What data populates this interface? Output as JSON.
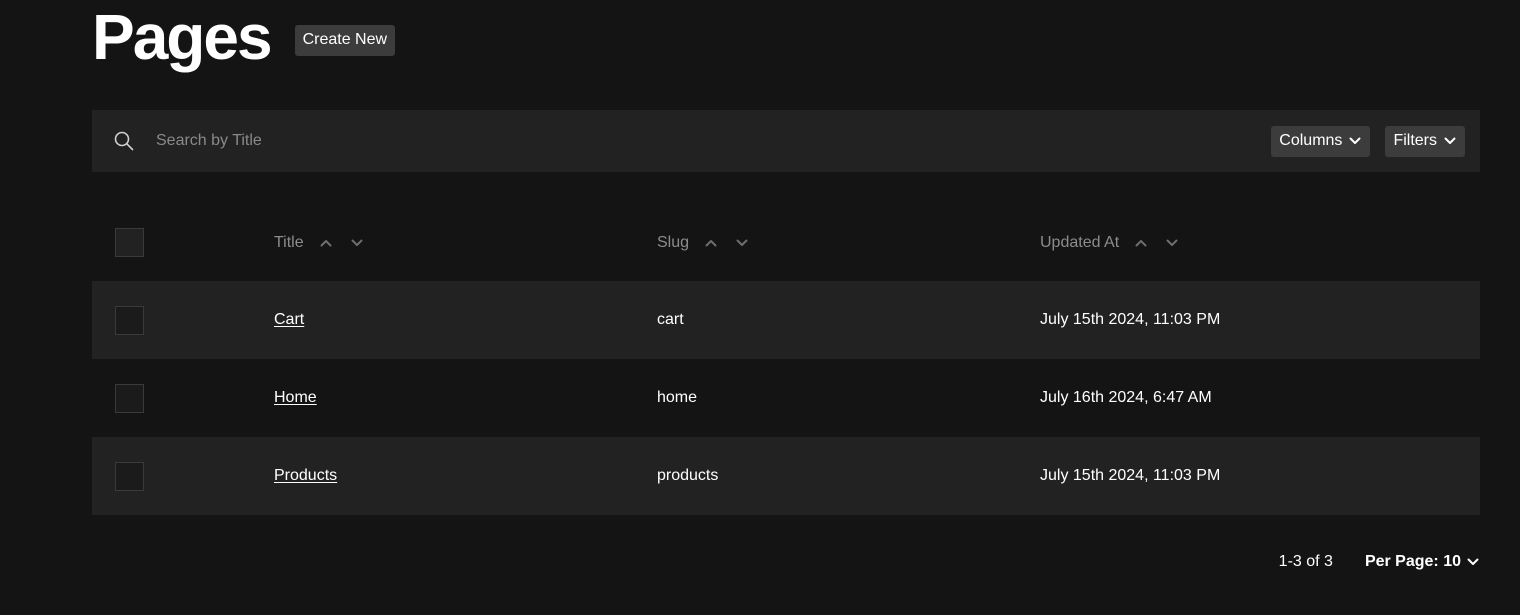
{
  "header": {
    "title": "Pages",
    "create_label": "Create New"
  },
  "search": {
    "placeholder": "Search by Title",
    "value": ""
  },
  "toolbar": {
    "columns_label": "Columns",
    "filters_label": "Filters"
  },
  "table": {
    "columns": [
      "Title",
      "Slug",
      "Updated At"
    ],
    "rows": [
      {
        "title": "Cart",
        "slug": "cart",
        "updated_at": "July 15th 2024, 11:03 PM"
      },
      {
        "title": "Home",
        "slug": "home",
        "updated_at": "July 16th 2024, 6:47 AM"
      },
      {
        "title": "Products",
        "slug": "products",
        "updated_at": "July 15th 2024, 11:03 PM"
      }
    ]
  },
  "pagination": {
    "range_text": "1-3 of 3",
    "per_page_label": "Per Page: 10"
  },
  "icons": {
    "search": "search-icon",
    "dropdown": "chevron-down-icon",
    "sort_asc": "chevron-up-icon",
    "sort_desc": "chevron-down-icon"
  },
  "colors": {
    "background": "#141414",
    "surface": "#222222",
    "button": "#3c3c3c",
    "muted_text": "#8c8c8c",
    "text": "#ffffff"
  }
}
